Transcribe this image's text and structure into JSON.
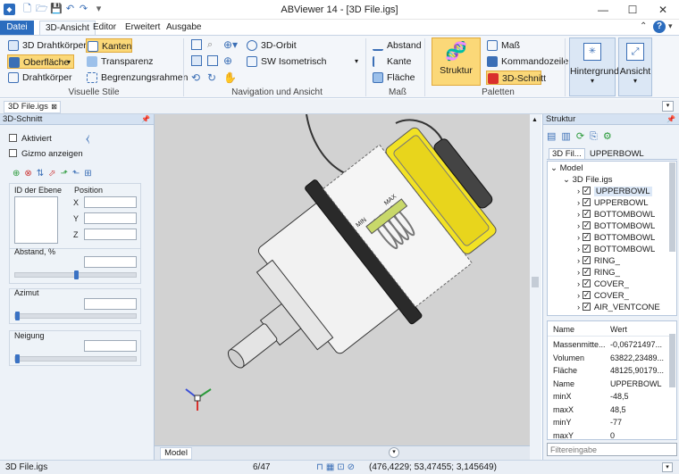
{
  "window": {
    "title": "ABViewer 14 - [3D File.igs]"
  },
  "ribbon_tabs": [
    "Datei",
    "3D-Ansicht",
    "Editor",
    "Erweitert",
    "Ausgabe"
  ],
  "ribbon": {
    "visuelle_stile": {
      "label": "Visuelle Stile",
      "btn1": "3D Drahtkörper",
      "btn2": "Oberfläche",
      "btn3": "Drahtkörper",
      "btn4": "Kanten",
      "btn5": "Transparenz",
      "btn6": "Begrenzungsrahmen"
    },
    "navigation": {
      "label": "Navigation und Ansicht",
      "orbit": "3D-Orbit",
      "iso": "SW Isometrisch"
    },
    "mass": {
      "label": "Maß",
      "abstand": "Abstand",
      "kante": "Kante",
      "flaeche": "Fläche"
    },
    "paletten": {
      "label": "Paletten",
      "struktur": "Struktur",
      "mass": "Maß",
      "kommandozeile": "Kommandozeile",
      "schnitt": "3D-Schnitt"
    },
    "hintergrund": "Hintergrund",
    "ansicht": "Ansicht"
  },
  "document_tab": "3D File.igs",
  "left_panel": {
    "title": "3D-Schnitt",
    "aktiviert": "Aktiviert",
    "gizmo": "Gizmo anzeigen",
    "id_label": "ID der Ebene",
    "position_label": "Position",
    "x": "X",
    "y": "Y",
    "z": "Z",
    "abstand": "Abstand, %",
    "azimut": "Azimut",
    "neigung": "Neigung"
  },
  "viewport": {
    "min_label": "MIN",
    "max_label": "MAX",
    "model_tab": "Model"
  },
  "right_panel": {
    "title": "Struktur",
    "tabs": [
      "3D Fil...",
      "UPPERBOWL"
    ],
    "tree_root": "Model",
    "tree_file": "3D File.igs",
    "tree_items": [
      "UPPERBOWL",
      "UPPERBOWL",
      "BOTTOMBOWL",
      "BOTTOMBOWL",
      "BOTTOMBOWL",
      "BOTTOMBOWL",
      "RING_",
      "RING_",
      "COVER_",
      "COVER_",
      "AIR_VENTCONE"
    ],
    "prop_headers": [
      "Name",
      "Wert"
    ],
    "props": [
      [
        "Massenmitte...",
        "-0,06721497..."
      ],
      [
        "Volumen",
        "63822,23489..."
      ],
      [
        "Fläche",
        "48125,90179..."
      ],
      [
        "Name",
        "UPPERBOWL"
      ],
      [
        "minX",
        "-48,5"
      ],
      [
        "maxX",
        "48,5"
      ],
      [
        "minY",
        "-77"
      ],
      [
        "maxY",
        "0"
      ]
    ],
    "filter_placeholder": "Filtereingabe"
  },
  "status": {
    "file": "3D File.igs",
    "page": "6/47",
    "coords": "(476,4229; 53,47455; 3,145649)"
  },
  "colors": {
    "accent": "#2b6cbe",
    "highlight": "#fbd878",
    "yellow_part": "#f2e224"
  }
}
